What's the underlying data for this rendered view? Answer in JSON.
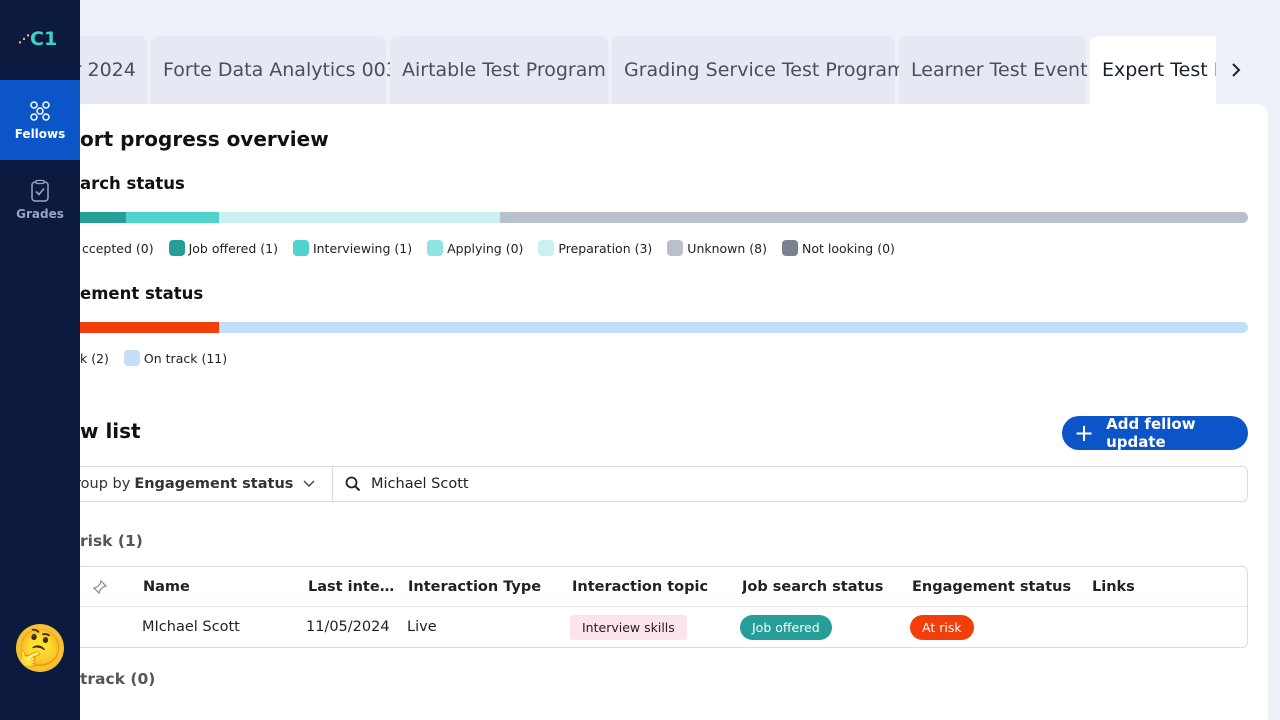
{
  "sidebar": {
    "logo_text": "C1",
    "items": [
      {
        "label": "Fellows",
        "icon": "fellows-icon",
        "active": true
      },
      {
        "label": "Grades",
        "icon": "grades-icon",
        "active": false
      }
    ],
    "avatar_emoji": "🤔"
  },
  "tabs": [
    {
      "label": "or 2024",
      "active": false
    },
    {
      "label": "Forte Data Analytics 003",
      "active": false
    },
    {
      "label": "Airtable Test Program",
      "active": false
    },
    {
      "label": "Grading Service Test Program",
      "active": false
    },
    {
      "label": "Learner Test Event",
      "active": false
    },
    {
      "label": "Expert Test P",
      "active": true
    }
  ],
  "overview": {
    "title": "ort progress overview",
    "job_search": {
      "title": "arch status",
      "segments": [
        {
          "label": "ccepted (0)",
          "color": "#1f8f89",
          "value": 1
        },
        {
          "label": "Job offered (1)",
          "color": "#259e98",
          "value": 1
        },
        {
          "label": "Interviewing (1)",
          "color": "#4fd3cf",
          "value": 1
        },
        {
          "label": "Applying (0)",
          "color": "#8fe3e0",
          "value": 0
        },
        {
          "label": "Preparation (3)",
          "color": "#c9f1ef",
          "value": 3
        },
        {
          "label": "Unknown (8)",
          "color": "#b9bfcb",
          "value": 8
        },
        {
          "label": "Not looking (0)",
          "color": "#7b818d",
          "value": 0
        }
      ]
    },
    "engagement": {
      "title": "ement status",
      "segments": [
        {
          "label": "k (2)",
          "color": "#f23e0b",
          "value": 2
        },
        {
          "label": "On track (11)",
          "color": "#c4ddfa",
          "value": 11
        }
      ]
    }
  },
  "fellow_list": {
    "title": "w list",
    "add_button": "Add fellow update",
    "groupby_prefix": "roup by",
    "groupby_value": "Engagement status",
    "search_value": "Michael Scott",
    "groups": [
      {
        "title": "risk (1)"
      },
      {
        "title": "track (0)"
      }
    ],
    "columns": [
      "Name",
      "Last inte…",
      "Interaction Type",
      "Interaction topic",
      "Job search status",
      "Engagement status",
      "Links"
    ],
    "rows": [
      {
        "name": "MIchael Scott",
        "last_interaction": "11/05/2024",
        "interaction_type": "Live",
        "interaction_topic": "Interview skills",
        "job_search_status": "Job offered",
        "engagement_status": "At risk",
        "links": ""
      }
    ]
  }
}
